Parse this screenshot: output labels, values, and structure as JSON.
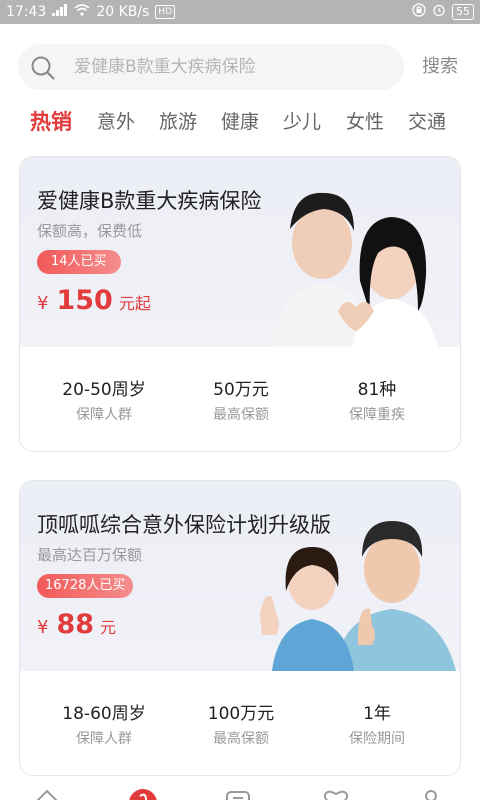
{
  "status_bar": {
    "time": "17:43",
    "network_speed": "20 KB/s",
    "battery": "55"
  },
  "search": {
    "placeholder": "爱健康B款重大疾病保险",
    "button_label": "搜索"
  },
  "tabs": [
    {
      "label": "热销",
      "active": true
    },
    {
      "label": "意外",
      "active": false
    },
    {
      "label": "旅游",
      "active": false
    },
    {
      "label": "健康",
      "active": false
    },
    {
      "label": "少儿",
      "active": false
    },
    {
      "label": "女性",
      "active": false
    },
    {
      "label": "交通",
      "active": false
    }
  ],
  "products": [
    {
      "title": "爱健康B款重大疾病保险",
      "subtitle": "保额高，保费低",
      "buyers": "14人已买",
      "currency": "¥",
      "price": "150",
      "price_unit": "元起",
      "stats": [
        {
          "value": "20-50周岁",
          "label": "保障人群"
        },
        {
          "value": "50万元",
          "label": "最高保额"
        },
        {
          "value": "81种",
          "label": "保障重疾"
        }
      ]
    },
    {
      "title": "顶呱呱综合意外保险计划升级版",
      "subtitle": "最高达百万保额",
      "buyers": "16728人已买",
      "currency": "¥",
      "price": "88",
      "price_unit": "元",
      "stats": [
        {
          "value": "18-60周岁",
          "label": "保障人群"
        },
        {
          "value": "100万元",
          "label": "最高保额"
        },
        {
          "value": "1年",
          "label": "保险期间"
        }
      ]
    }
  ],
  "bottom_nav": {
    "icons": [
      "home-icon",
      "hot-icon",
      "list-icon",
      "heart-icon",
      "user-icon"
    ]
  },
  "colors": {
    "accent": "#e23b3b",
    "status_bar": "#b4b4b4",
    "card_header": "#eceef5"
  }
}
